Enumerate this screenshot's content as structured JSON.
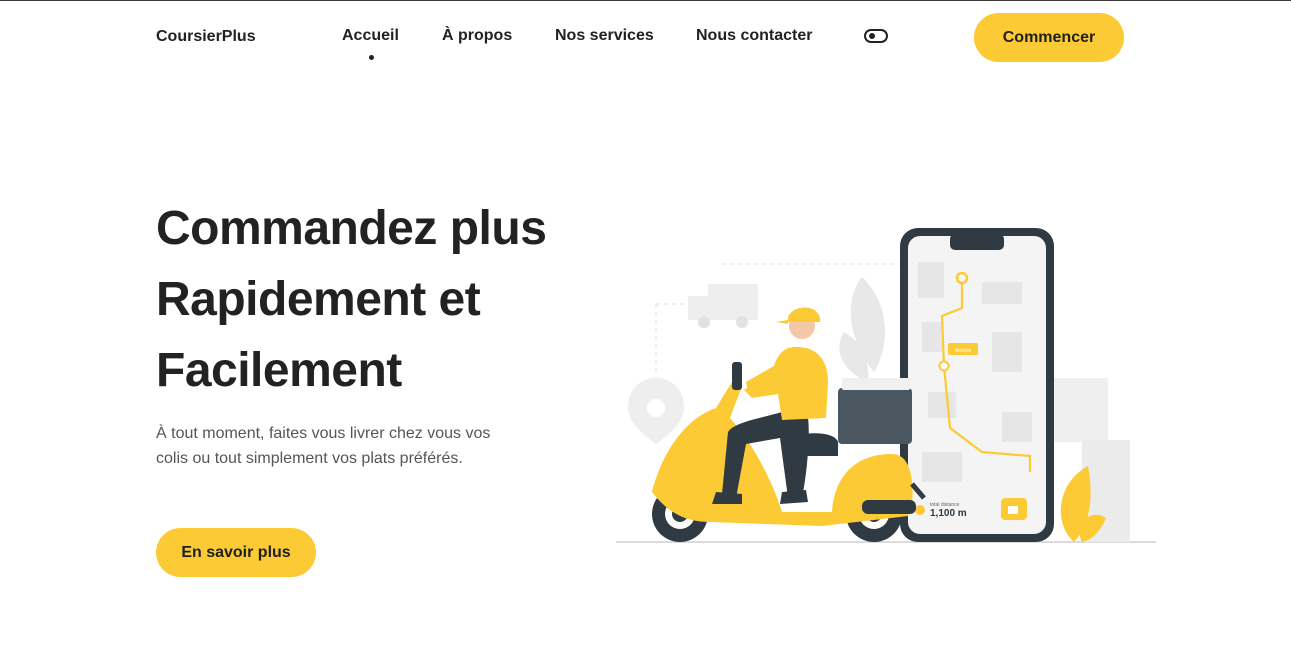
{
  "nav": {
    "brand": "CoursierPlus",
    "links": [
      "Accueil",
      "À propos",
      "Nos services",
      "Nous contacter"
    ],
    "active_link": "Accueil",
    "cta": "Commencer"
  },
  "hero": {
    "title_lines": [
      "Commandez plus",
      "Rapidement et",
      "Facilement"
    ],
    "description": "À tout moment, faites vous livrer chez vous vos colis ou tout simplement vos plats préférés.",
    "button": "En savoir plus"
  },
  "illustration": {
    "phone_label": "1,100 m",
    "phone_sublabel": "total distance",
    "map_tag": "lifestyle"
  },
  "colors": {
    "accent": "#fcca34",
    "text": "#222222",
    "muted": "#555555"
  }
}
